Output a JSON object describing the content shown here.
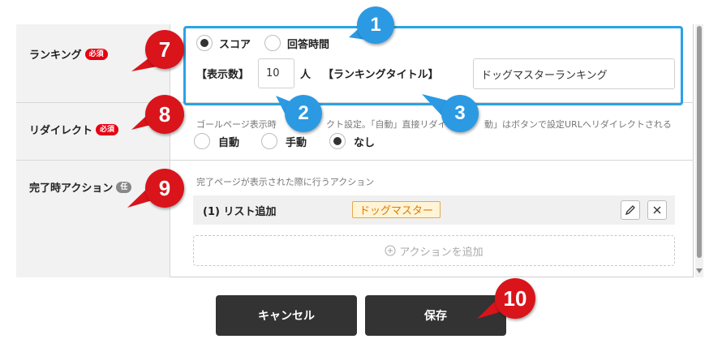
{
  "ranking": {
    "label": "ランキング",
    "required": "必須",
    "options": [
      "スコア",
      "回答時間"
    ],
    "selected": "スコア",
    "display_count_label": "【表示数】",
    "display_count_value": "10",
    "display_count_unit": "人",
    "title_label": "【ランキングタイトル】",
    "title_value": "ドッグマスターランキング"
  },
  "redirect": {
    "label": "リダイレクト",
    "required": "必須",
    "desc_left": "ゴールページ表示時",
    "desc_mid1": "クト設定。「自動」直接リダイレ",
    "desc_mid2": "動」はボタンで設定URLへリダイレクトされる",
    "options": [
      "自動",
      "手動",
      "なし"
    ],
    "selected": "なし"
  },
  "completion_action": {
    "label": "完了時アクション",
    "optional": "任",
    "desc": "完了ページが表示された際に行うアクション",
    "item_label": "(1) リスト追加",
    "item_tag": "ドッグマスター",
    "add_label": "アクションを追加"
  },
  "buttons": {
    "cancel": "キャンセル",
    "save": "保存"
  },
  "callouts": [
    "1",
    "2",
    "3",
    "7",
    "8",
    "9",
    "10"
  ],
  "colors": {
    "callout_red": "#d9141b",
    "callout_blue": "#2b9ae2",
    "highlight": "#2aa3e6",
    "required_badge": "#e60012",
    "button": "#333333"
  },
  "icons": {
    "edit": "pencil-icon",
    "delete": "close-icon",
    "add": "plus-circle-icon"
  }
}
